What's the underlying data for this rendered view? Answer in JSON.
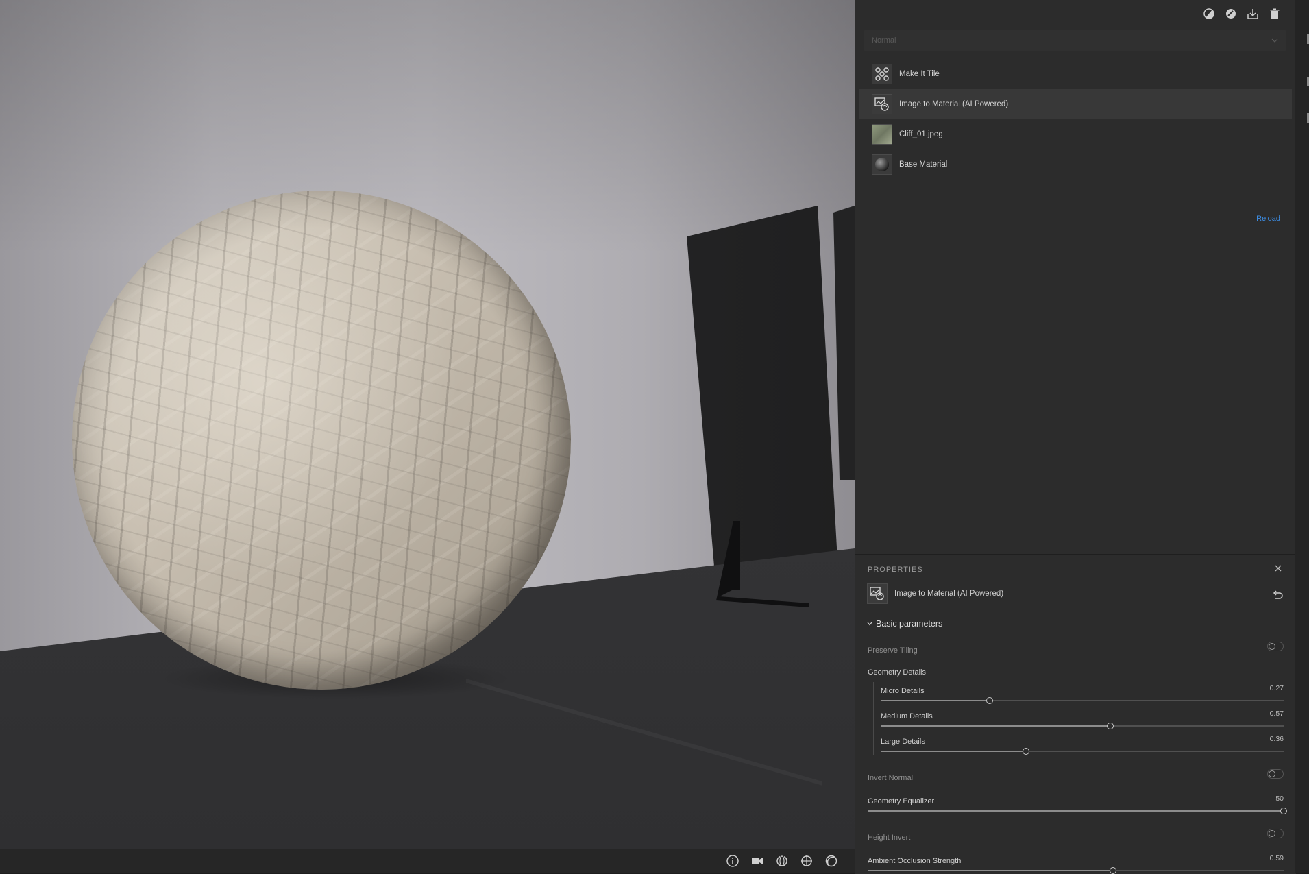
{
  "toolbar_icons": [
    "mask-icon",
    "paint-layer-icon",
    "export-icon",
    "delete-icon"
  ],
  "blend_mode": {
    "value": "Normal"
  },
  "layers": [
    {
      "label": "Make It Tile",
      "icon": "tile-pattern-icon",
      "selected": false
    },
    {
      "label": "Image to Material (AI Powered)",
      "icon": "image-to-material-icon",
      "selected": true
    },
    {
      "label": "Cliff_01.jpeg",
      "icon": "image-thumbnail-icon",
      "selected": false
    },
    {
      "label": "Base Material",
      "icon": "sphere-material-icon",
      "selected": false
    }
  ],
  "reload_label": "Reload",
  "properties": {
    "title": "PROPERTIES",
    "layer_name": "Image to Material (AI Powered)",
    "section": "Basic parameters",
    "preserve_tiling": {
      "label": "Preserve Tiling",
      "on": false
    },
    "geometry_details": {
      "label": "Geometry Details"
    },
    "micro": {
      "label": "Micro Details",
      "value": "0.27",
      "fraction": 0.27
    },
    "medium": {
      "label": "Medium Details",
      "value": "0.57",
      "fraction": 0.57
    },
    "large": {
      "label": "Large Details",
      "value": "0.36",
      "fraction": 0.36
    },
    "invert_normal": {
      "label": "Invert Normal",
      "on": false
    },
    "equalizer": {
      "label": "Geometry Equalizer",
      "value": "50",
      "fraction": 1.0
    },
    "height_invert": {
      "label": "Height Invert",
      "on": false
    },
    "ao": {
      "label": "Ambient Occlusion Strength",
      "value": "0.59",
      "fraction": 0.59
    }
  },
  "viewport_icons": [
    "info-icon",
    "camera-icon",
    "rotate-view-icon",
    "target-icon",
    "environment-icon"
  ]
}
